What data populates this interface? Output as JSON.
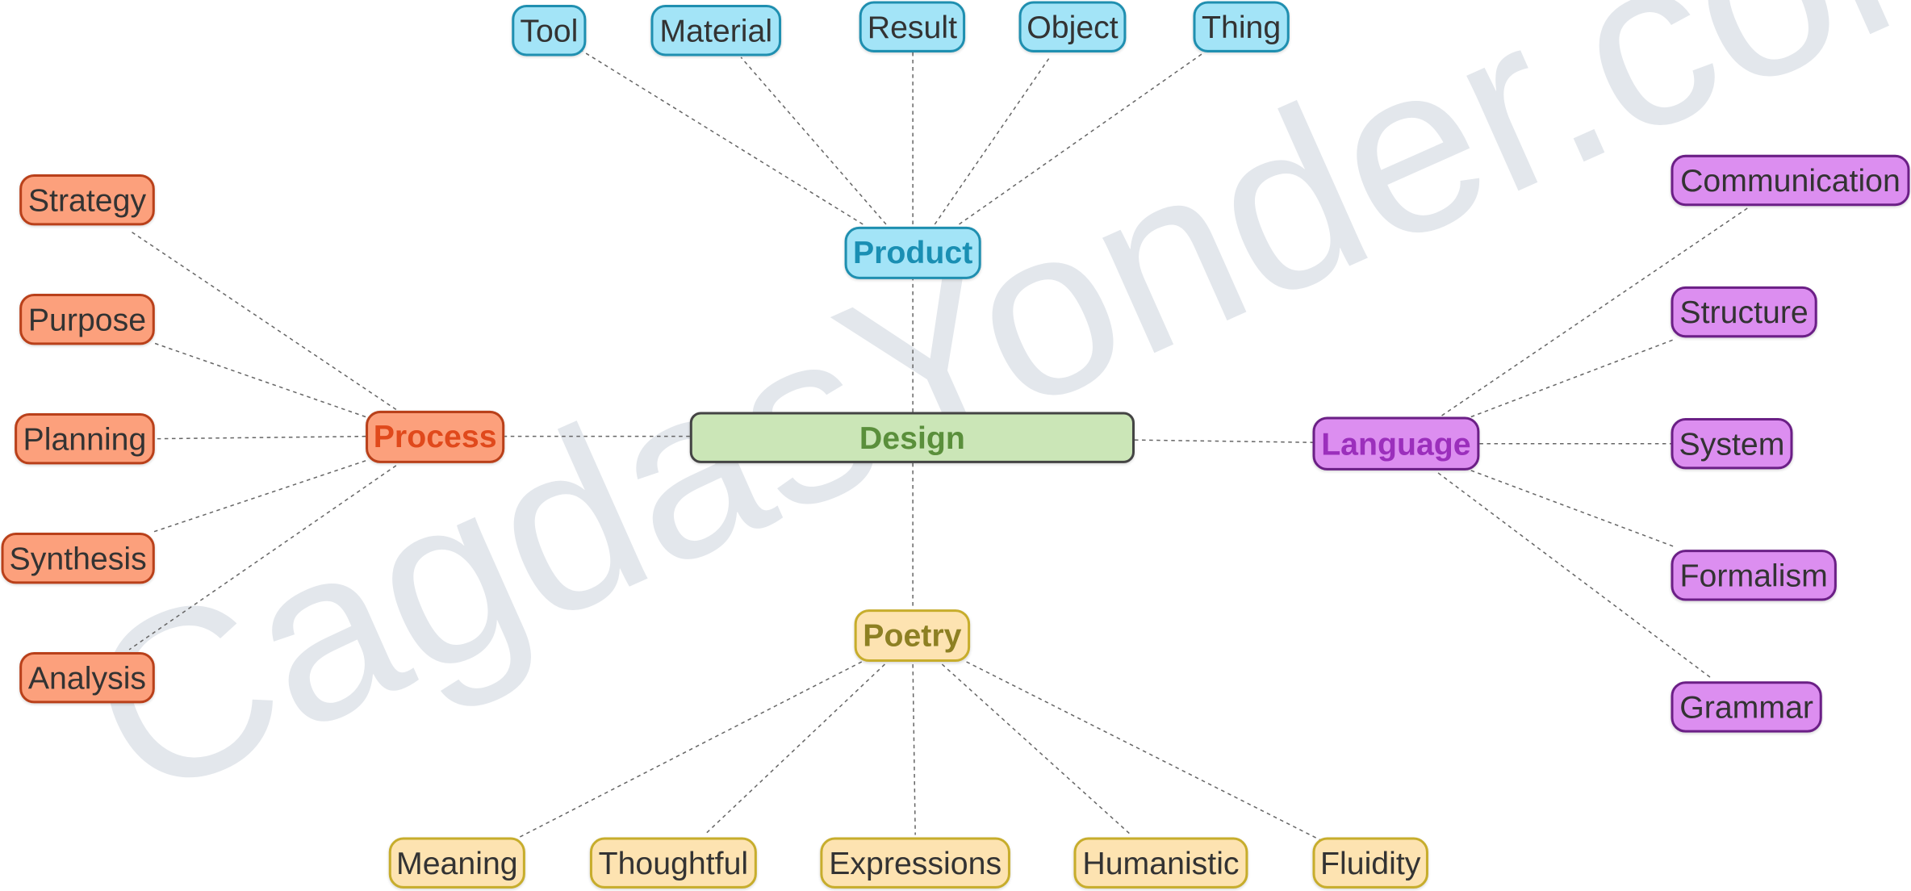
{
  "watermark": "CagdasYonder.com",
  "center": {
    "label": "Design",
    "color": "#cbe6b7"
  },
  "branches": {
    "product": {
      "label": "Product",
      "color": "#a3e4f7",
      "children": [
        "Tool",
        "Material",
        "Result",
        "Object",
        "Thing"
      ]
    },
    "process": {
      "label": "Process",
      "color": "#fca07c",
      "children": [
        "Strategy",
        "Purpose",
        "Planning",
        "Synthesis",
        "Analysis"
      ]
    },
    "language": {
      "label": "Language",
      "color": "#dc8ef0",
      "children": [
        "Communication",
        "Structure",
        "System",
        "Formalism",
        "Grammar"
      ]
    },
    "poetry": {
      "label": "Poetry",
      "color": "#fde3b1",
      "children": [
        "Meaning",
        "Thoughtful",
        "Expressions",
        "Humanistic",
        "Fluidity"
      ]
    }
  }
}
